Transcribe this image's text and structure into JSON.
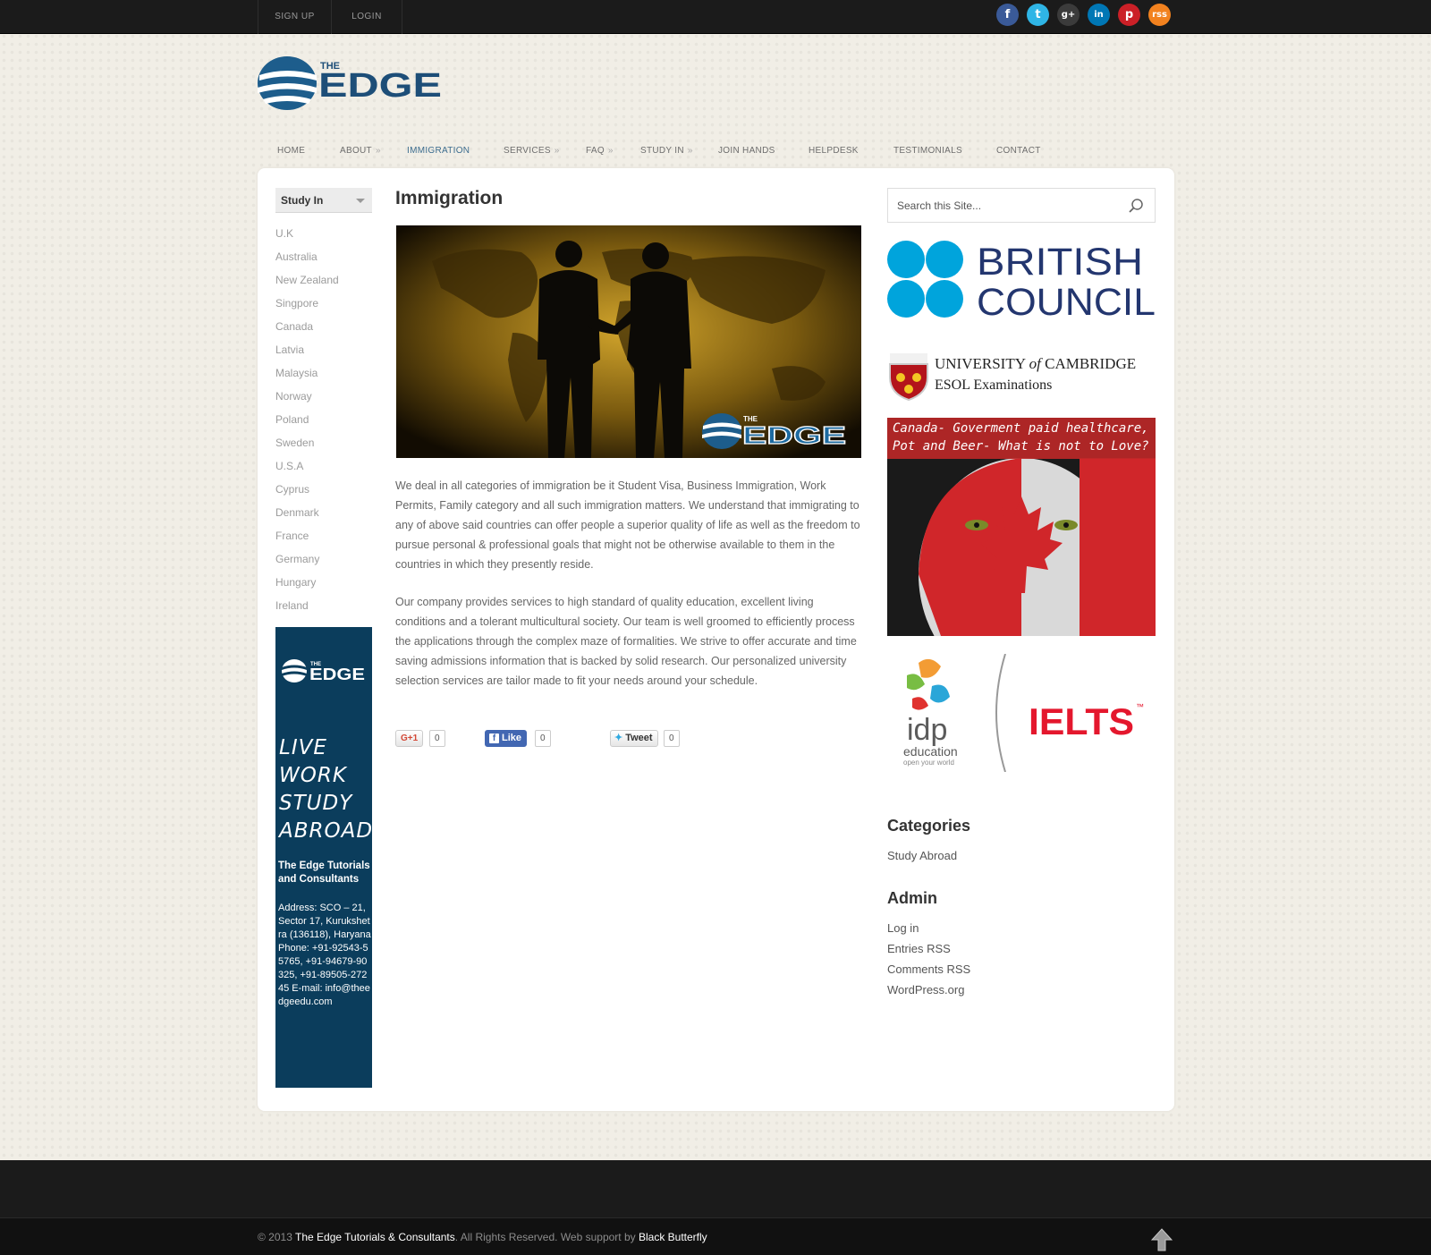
{
  "topbar": {
    "signup": "SIGN UP",
    "login": "LOGIN",
    "social": [
      {
        "name": "facebook",
        "glyph": "f",
        "color": "#3a5a98"
      },
      {
        "name": "twitter",
        "glyph": "t",
        "color": "#2fb5e6"
      },
      {
        "name": "google-plus",
        "glyph": "g+",
        "color": "#3b3b3b"
      },
      {
        "name": "linkedin",
        "glyph": "in",
        "color": "#0077b5"
      },
      {
        "name": "pinterest",
        "glyph": "p",
        "color": "#cb2027"
      },
      {
        "name": "rss",
        "glyph": "rss",
        "color": "#f2821f"
      }
    ]
  },
  "logo": {
    "top": "THE",
    "main": "EDGE"
  },
  "nav": [
    "HOME",
    "ABOUT",
    "IMMIGRATION",
    "SERVICES",
    "FAQ",
    "STUDY IN",
    "JOIN HANDS",
    "HELPDESK",
    "TESTIMONIALS",
    "CONTACT"
  ],
  "nav_raquo": "»",
  "sidebar": {
    "dropdown": "Study In",
    "countries": [
      "U.K",
      "Australia",
      "New Zealand",
      "Singpore",
      "Canada",
      "Latvia",
      "Malaysia",
      "Norway",
      "Poland",
      "Sweden",
      "U.S.A",
      "Cyprus",
      "Denmark",
      "France",
      "Germany",
      "Hungary",
      "Ireland"
    ]
  },
  "banner": {
    "logo_top": "THE",
    "logo_main": "EDGE",
    "tagline": [
      "LIVE",
      "WORK",
      "STUDY",
      "ABROAD"
    ],
    "company": "The Edge Tutorials and Consultants",
    "address": "Address: SCO – 21, Sector 17, Kurukshetra (136118), Haryana Phone: +91-92543-55765, +91-94679-90325, +91-89505-27245 E-mail: info@theedgeedu.com"
  },
  "main": {
    "title": "Immigration",
    "hero_logo_top": "THE",
    "hero_logo_main": "EDGE",
    "para1": "We deal in all categories of immigration be it Student Visa, Business Immigration, Work Permits, Family category and all such immigration matters. We understand that immigrating to any of above said countries can offer people a superior quality of life as well as the freedom to pursue personal & professional goals that might not be otherwise available to them in the countries in which they presently reside.",
    "para2": "Our company provides services to high standard of quality education, excellent living conditions and a tolerant multicultural society. Our team is well groomed to efficiently process the applications through the complex maze of formalities. We strive to offer accurate and time saving admissions information that is backed by solid research. Our personalized university selection services are tailor made to fit your needs around your schedule.",
    "share": {
      "gplus": "G+1",
      "gplus_count": "0",
      "like": "Like",
      "like_count": "0",
      "tweet": "Tweet",
      "tweet_count": "0"
    }
  },
  "right": {
    "search_placeholder": "Search this Site...",
    "british_council": [
      "BRITISH",
      "COUNCIL"
    ],
    "cambridge_line1a": "UNIVERSITY",
    "cambridge_line1b": "of",
    "cambridge_line1c": "CAMBRIDGE",
    "cambridge_line2": "ESOL Examinations",
    "canada_caption": "Canada- Goverment paid healthcare, Pot and Beer- What is not to Love?",
    "idp_main": "idp",
    "idp_sub": "education",
    "idp_tag": "open your world",
    "ielts": "IELTS",
    "ielts_tm": "™",
    "categories_title": "Categories",
    "categories": [
      "Study Abroad"
    ],
    "admin_title": "Admin",
    "admin_links": [
      "Log in",
      "Entries RSS",
      "Comments RSS",
      "WordPress.org"
    ]
  },
  "footer": {
    "year": "© 2013",
    "company": "The Edge Tutorials & Consultants",
    "rights": ". All Rights Reserved. Web support by",
    "support": "Black Butterfly"
  },
  "colors": {
    "accent": "#3d6d8f",
    "banner": "#0b3d5c",
    "british_council": "#00a4dc",
    "ielts": "#e4172d"
  }
}
